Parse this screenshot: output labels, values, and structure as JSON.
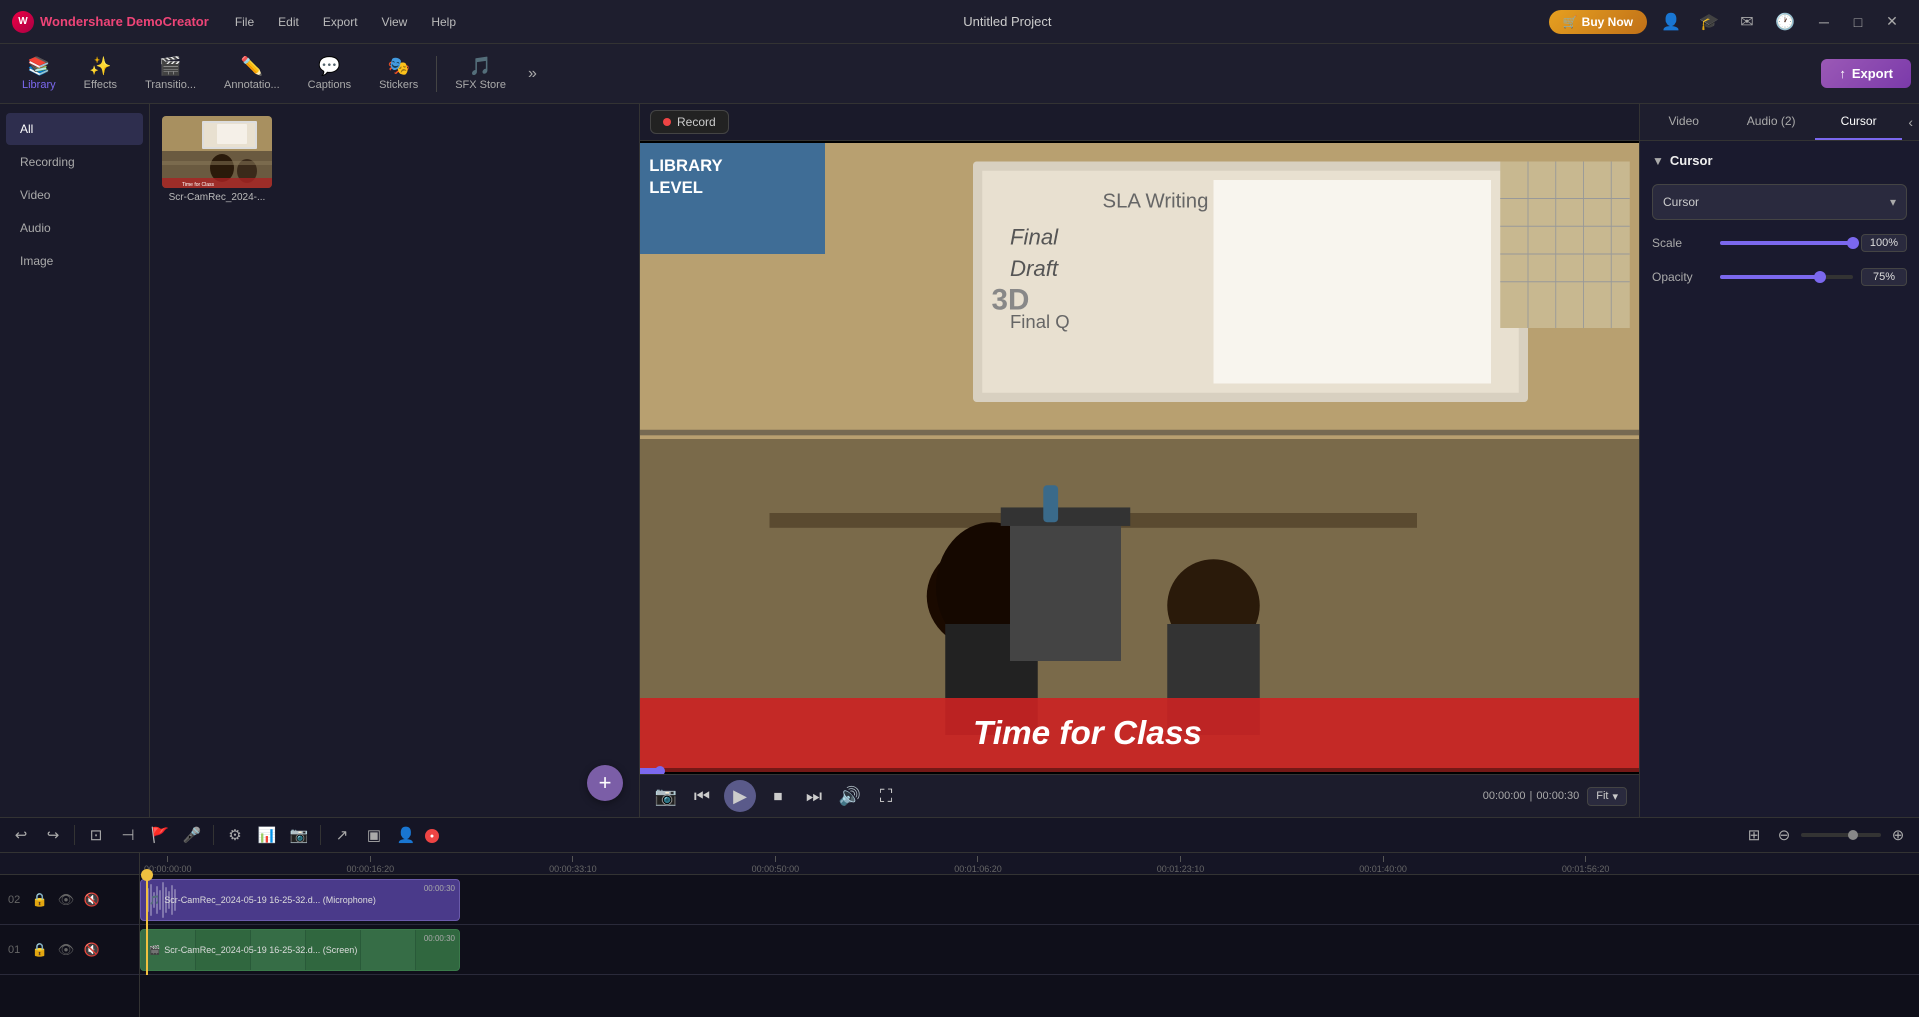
{
  "app": {
    "name": "Wondershare DemoCreator",
    "title": "Untitled Project"
  },
  "menu": {
    "items": [
      "File",
      "Edit",
      "Export",
      "View",
      "Help"
    ]
  },
  "topbar": {
    "buy_now": "Buy Now",
    "export_label": "Export"
  },
  "toolbar": {
    "items": [
      {
        "id": "library",
        "label": "Library",
        "icon": "📚",
        "active": true
      },
      {
        "id": "effects",
        "label": "Effects",
        "icon": "✨"
      },
      {
        "id": "transitions",
        "label": "Transitio...",
        "icon": "🎬"
      },
      {
        "id": "annotations",
        "label": "Annotatio...",
        "icon": "✏️"
      },
      {
        "id": "captions",
        "label": "Captions",
        "icon": "💬"
      },
      {
        "id": "stickers",
        "label": "Stickers",
        "icon": "🎭"
      },
      {
        "id": "sfx_store",
        "label": "SFX Store",
        "icon": "🎵"
      }
    ]
  },
  "library": {
    "categories": [
      {
        "id": "all",
        "label": "All",
        "active": true
      },
      {
        "id": "recording",
        "label": "Recording"
      },
      {
        "id": "video",
        "label": "Video"
      },
      {
        "id": "audio",
        "label": "Audio"
      },
      {
        "id": "image",
        "label": "Image"
      }
    ],
    "media": [
      {
        "id": "clip1",
        "name": "Scr-CamRec_2024-..."
      }
    ]
  },
  "record": {
    "label": "Record"
  },
  "video_player": {
    "time_current": "00:00:00",
    "time_separator": "|",
    "time_total": "00:00:30",
    "fit_label": "Fit"
  },
  "right_panel": {
    "tabs": [
      {
        "id": "video",
        "label": "Video"
      },
      {
        "id": "audio",
        "label": "Audio (2)"
      },
      {
        "id": "cursor",
        "label": "Cursor",
        "active": true
      }
    ],
    "cursor_section": {
      "title": "Cursor",
      "cursor_label": "Cursor",
      "scale_label": "Scale",
      "scale_value": "100%",
      "scale_percent": 100,
      "opacity_label": "Opacity",
      "opacity_value": "75%",
      "opacity_percent": 75
    }
  },
  "timeline": {
    "ruler_marks": [
      "00:00:00:00",
      "00:00:16:20",
      "00:00:33:10",
      "00:00:50:00",
      "00:01:06:20",
      "00:01:23:10",
      "00:01:40:00",
      "00:01:56:20"
    ],
    "tracks": [
      {
        "num": "02",
        "clip": {
          "type": "audio",
          "label": "Scr-CamRec_2024-05-19 16-25-32.d... (Microphone)",
          "duration": "00:00:30",
          "icon": "🎵"
        }
      },
      {
        "num": "01",
        "clip": {
          "type": "video",
          "label": "Scr-CamRec_2024-05-19 16-25-32.d... (Screen)",
          "duration": "00:00:30",
          "icon": "🎬"
        }
      }
    ]
  },
  "window_controls": {
    "minimize": "─",
    "maximize": "□",
    "close": "✕"
  }
}
